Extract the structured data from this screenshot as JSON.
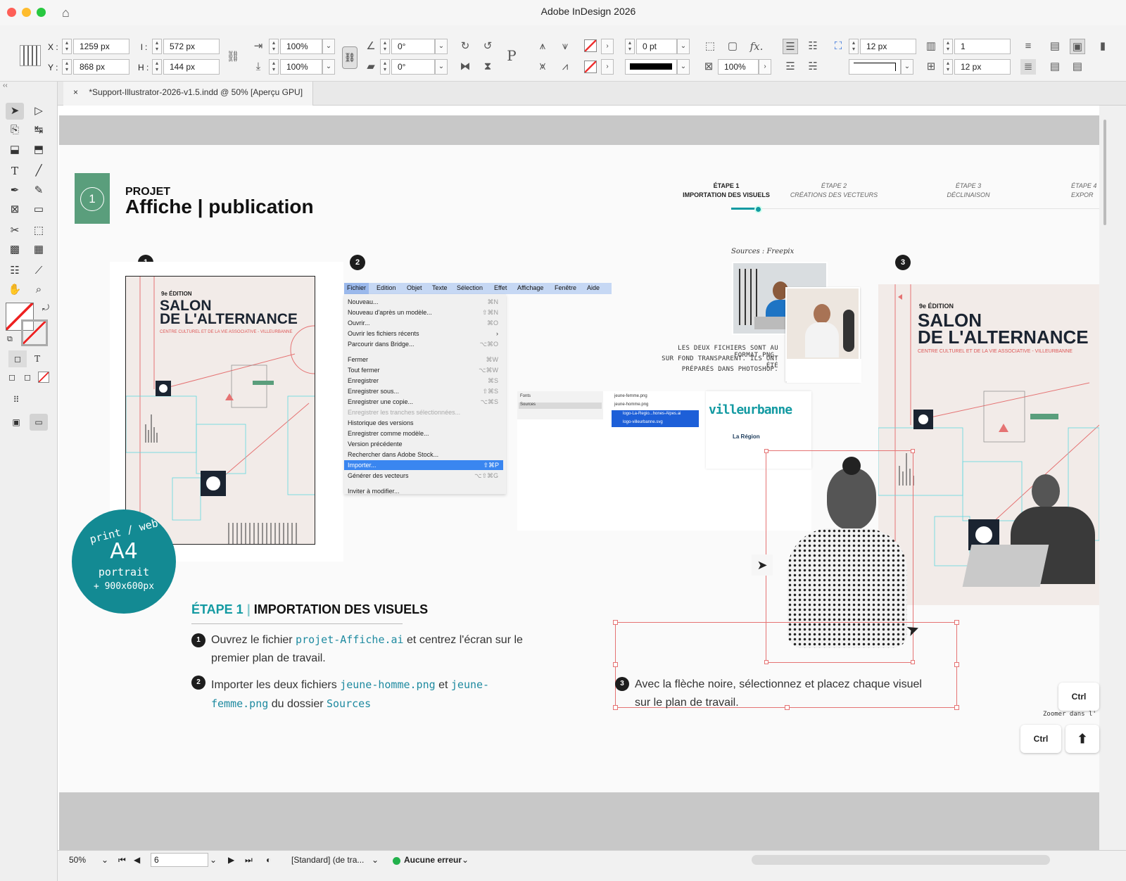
{
  "app": {
    "title": "Adobe InDesign 2026"
  },
  "control_bar": {
    "x_label": "X :",
    "x_value": "1259 px",
    "y_label": "Y :",
    "y_value": "868 px",
    "w_label": "l :",
    "w_value": "572 px",
    "h_label": "H :",
    "h_value": "144 px",
    "scale_x": "100%",
    "scale_y": "100%",
    "angle": "0°",
    "shear": "0°",
    "stroke_weight": "0 pt",
    "opacity": "100%",
    "gap1": "12 px",
    "gap2": "12 px",
    "columns": "1",
    "gutter": "12 px"
  },
  "doc_tab": {
    "close": "×",
    "label": "*Support-Illustrator-2026-v1.5.indd @ 50% [Aperçu GPU]"
  },
  "page": {
    "step_number": "1",
    "project_label": "PROJET",
    "project_title": "Affiche | publication",
    "progress": [
      {
        "label": "ÉTAPE 1",
        "sub": "IMPORTATION DES VISUELS",
        "active": true
      },
      {
        "label": "ÉTAPE 2",
        "sub": "CRÉATIONS DES VECTEURS",
        "active": false
      },
      {
        "label": "ÉTAPE 3",
        "sub": "DÉCLINAISON",
        "active": false
      },
      {
        "label": "ÉTAPE 4",
        "sub": "EXPOR",
        "active": false
      }
    ],
    "markers": [
      "1",
      "2",
      "3"
    ],
    "poster": {
      "edition": "9e ÉDITION",
      "title1": "SALON",
      "title2": "DE L'ALTERNANCE",
      "subtitle": "CENTRE CULTUREL ET DE LA VIE ASSOCIATIVE - VILLEURBANNE"
    },
    "menu_bar": [
      "Fichier",
      "Edition",
      "Objet",
      "Texte",
      "Sélection",
      "Effet",
      "Affichage",
      "Fenêtre",
      "Aide"
    ],
    "menu_items": [
      {
        "label": "Nouveau...",
        "shortcut": "⌘N"
      },
      {
        "label": "Nouveau d'après un modèle...",
        "shortcut": "⇧⌘N"
      },
      {
        "label": "Ouvrir...",
        "shortcut": "⌘O"
      },
      {
        "label": "Ouvrir les fichiers récents",
        "shortcut": "›"
      },
      {
        "label": "Parcourir dans Bridge...",
        "shortcut": "⌥⌘O"
      },
      {
        "label": "Fermer",
        "shortcut": "⌘W"
      },
      {
        "label": "Tout fermer",
        "shortcut": "⌥⌘W"
      },
      {
        "label": "Enregistrer",
        "shortcut": "⌘S"
      },
      {
        "label": "Enregistrer sous...",
        "shortcut": "⇧⌘S"
      },
      {
        "label": "Enregistrer une copie...",
        "shortcut": "⌥⌘S"
      },
      {
        "label": "Enregistrer les tranches sélectionnées...",
        "shortcut": ""
      },
      {
        "label": "Historique des versions",
        "shortcut": ""
      },
      {
        "label": "Enregistrer comme modèle...",
        "shortcut": ""
      },
      {
        "label": "Version précédente",
        "shortcut": ""
      },
      {
        "label": "Rechercher dans Adobe Stock...",
        "shortcut": ""
      },
      {
        "label": "Importer...",
        "shortcut": "⇧⌘P"
      },
      {
        "label": "Générer des vecteurs",
        "shortcut": "⌥⇧⌘G"
      },
      {
        "label": "Inviter à modifier...",
        "shortcut": ""
      }
    ],
    "sources_label": "Sources : Freepix",
    "sources_note": [
      "LES DEUX FICHIERS SONT AU FORMAT PNG,",
      "SUR FOND TRANSPARENT. ILS ONT ÉTÉ",
      "PRÉPARÉS DANS PHOTOSHOP."
    ],
    "finder": {
      "folders": [
        "Fonts",
        "Sources"
      ],
      "files": [
        "jeune-femme.png",
        "jeune-homme.png",
        "logo-La-Regio...hones-Alpes.ai",
        "logo-villeurbanne.svg"
      ],
      "logo1": "villeurbanne",
      "logo2": "La Région"
    },
    "badge": {
      "line1": "print / web",
      "line2": "A4",
      "line3": "portrait",
      "line4": "+ 900x600px"
    },
    "step_title_a": "ÉTAPE 1",
    "step_title_sep": "|",
    "step_title_b": "IMPORTATION DES VISUELS",
    "instr1": {
      "n": "1",
      "t1": "Ouvrez le fichier ",
      "code": "projet-Affiche.ai",
      "t2": " et centrez l'écran sur le premier plan de travail."
    },
    "instr2": {
      "n": "2",
      "t1": "Importer les deux fichiers ",
      "code1": "jeune-homme.png",
      "t2": " et ",
      "code2": "jeune-femme.png",
      "t3": " du dossier ",
      "code3": "Sources"
    },
    "instr3": {
      "n": "3",
      "t": "Avec la flèche noire, sélectionnez et placez chaque visuel sur le plan de travail."
    },
    "keys": {
      "ctrl1": "Ctrl",
      "ctrl2": "Ctrl",
      "zoom_hint": "Zoomer dans l'"
    }
  },
  "status": {
    "zoom": "50%",
    "page": "6",
    "style": "[Standard] (de tra...",
    "errors": "Aucune erreur"
  },
  "colors": {
    "accent": "#139aa2",
    "green": "#5a9e7c",
    "poster_bg": "#f2ebe8",
    "navy": "#1b2431",
    "red_guide": "#e57373"
  }
}
